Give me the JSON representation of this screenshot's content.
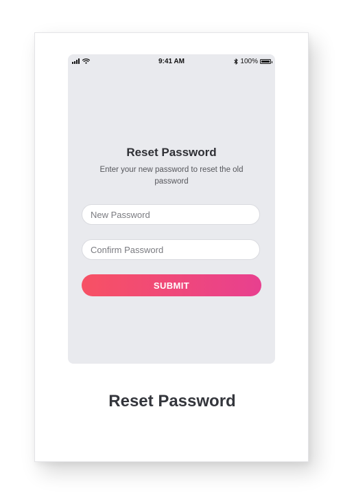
{
  "status_bar": {
    "time": "9:41 AM",
    "battery_text": "100%",
    "icons": [
      "signal-icon",
      "wifi-icon",
      "bluetooth-icon",
      "battery-icon"
    ]
  },
  "screen": {
    "title": "Reset Password",
    "description": "Enter your new password to reset the old password",
    "new_password_placeholder": "New Password",
    "confirm_password_placeholder": "Confirm Password",
    "submit_label": "SUBMIT"
  },
  "caption": "Reset Password",
  "colors": {
    "phone_background": "#e9eaee",
    "button_gradient_start": "#f75164",
    "button_gradient_end": "#e8408f",
    "title_text": "#2f3035"
  }
}
